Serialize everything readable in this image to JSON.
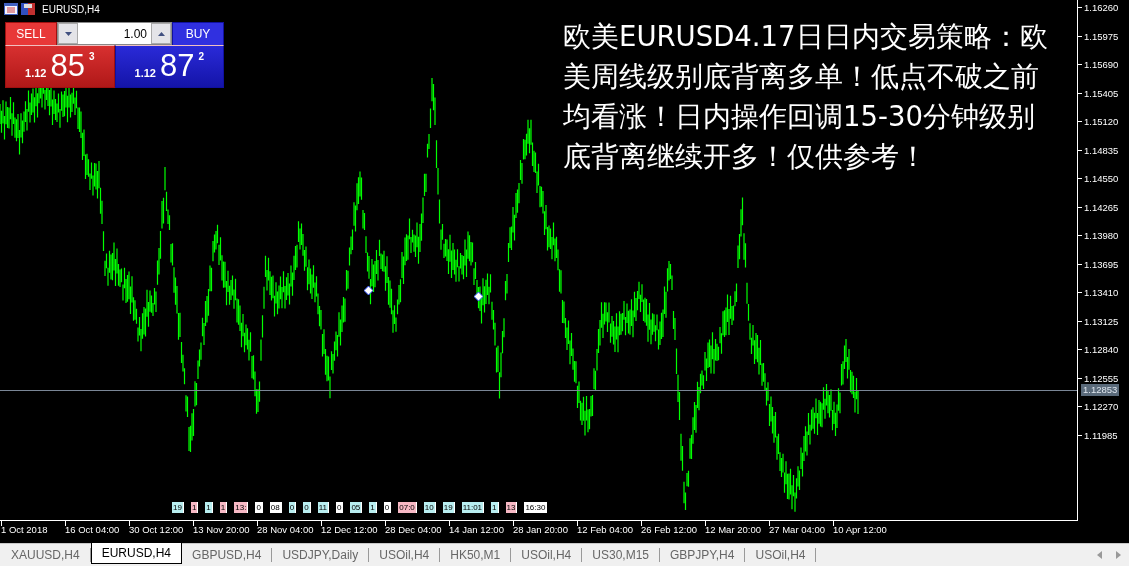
{
  "chart_header": {
    "symbol": "EURUSD,H4"
  },
  "trade_panel": {
    "sell_label": "SELL",
    "buy_label": "BUY",
    "lot": "1.00",
    "sell_price": {
      "prefix": "1.12",
      "big": "85",
      "sup": "3"
    },
    "buy_price": {
      "prefix": "1.12",
      "big": "87",
      "sup": "2"
    }
  },
  "overlay_text": [
    "欧美EURUSD4.17日日内交易策略：欧",
    "美周线级别底背离多单！低点不破之前",
    "均看涨！日内操作回调15-30分钟级别",
    "底背离继续开多！仅供参考！"
  ],
  "price_axis": {
    "labels": [
      "1.16260",
      "1.15975",
      "1.15690",
      "1.15405",
      "1.15120",
      "1.14835",
      "1.14550",
      "1.14265",
      "1.13980",
      "1.13695",
      "1.13410",
      "1.13125",
      "1.12840",
      "1.12555",
      "1.12270",
      "1.11985"
    ],
    "current_price": "1.12853"
  },
  "time_axis": {
    "labels": [
      "1 Oct 2018",
      "16 Oct 04:00",
      "30 Oct 12:00",
      "13 Nov 20:00",
      "28 Nov 04:00",
      "12 Dec 12:00",
      "28 Dec 04:00",
      "14 Jan 12:00",
      "28 Jan 20:00",
      "12 Feb 04:00",
      "26 Feb 12:00",
      "12 Mar 20:00",
      "27 Mar 04:00",
      "10 Apr 12:00"
    ]
  },
  "event_tags": [
    {
      "text": "19",
      "color": "#b8eef0"
    },
    {
      "text": "1",
      "color": "#f7b8c4"
    },
    {
      "text": "1",
      "color": "#b8eef0"
    },
    {
      "text": "1",
      "color": "#f7b8c4"
    },
    {
      "text": "13:",
      "color": "#f7b8c4"
    },
    {
      "text": "0",
      "color": "#ffffff"
    },
    {
      "text": "08",
      "color": "#ffffff"
    },
    {
      "text": "0",
      "color": "#b8eef0"
    },
    {
      "text": "0",
      "color": "#b8eef0"
    },
    {
      "text": "11",
      "color": "#b8eef0"
    },
    {
      "text": "0",
      "color": "#ffffff"
    },
    {
      "text": "05",
      "color": "#b8eef0"
    },
    {
      "text": "1",
      "color": "#b8eef0"
    },
    {
      "text": "0",
      "color": "#ffffff"
    },
    {
      "text": "07:0",
      "color": "#f7b8c4"
    },
    {
      "text": "10",
      "color": "#b8eef0"
    },
    {
      "text": "19",
      "color": "#b8eef0"
    },
    {
      "text": "11:01",
      "color": "#b8eef0"
    },
    {
      "text": "1",
      "color": "#b8eef0"
    },
    {
      "text": "13",
      "color": "#f7b8c4"
    },
    {
      "text": "16:30",
      "color": "#ffffff"
    }
  ],
  "tabs": [
    {
      "label": "XAUUSD,H4",
      "selected": false
    },
    {
      "label": "EURUSD,H4",
      "selected": true
    },
    {
      "label": "GBPUSD,H4",
      "selected": false
    },
    {
      "label": "USDJPY,Daily",
      "selected": false
    },
    {
      "label": "USOil,H4",
      "selected": false
    },
    {
      "label": "HK50,M1",
      "selected": false
    },
    {
      "label": "USOil,H4",
      "selected": false
    },
    {
      "label": "US30,M15",
      "selected": false
    },
    {
      "label": "GBPJPY,H4",
      "selected": false
    },
    {
      "label": "USOil,H4",
      "selected": false
    }
  ]
}
